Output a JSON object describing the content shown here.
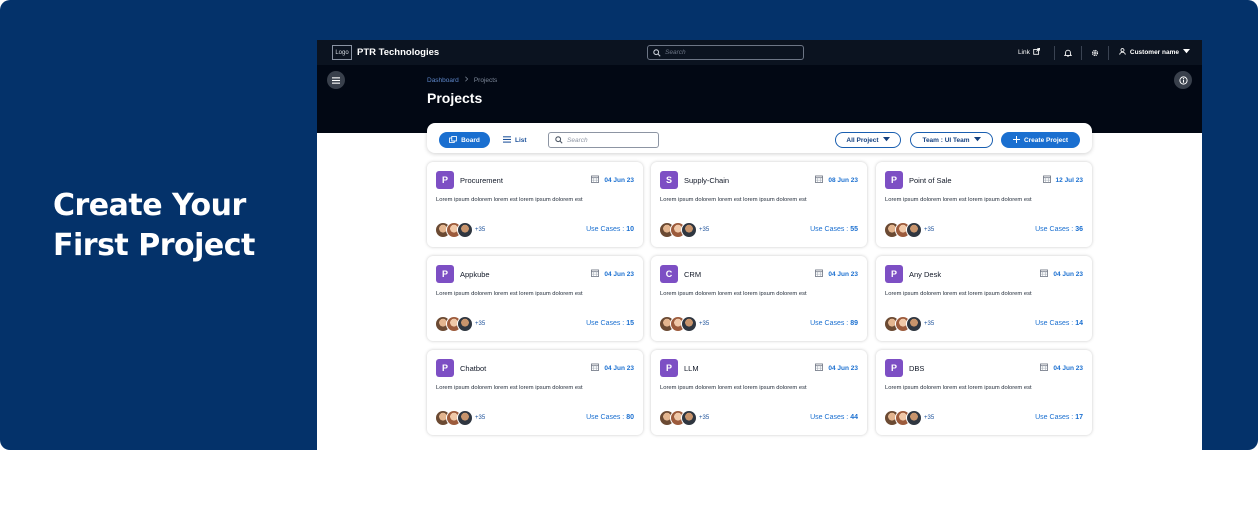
{
  "banner": {
    "headline": "Create Your First Project"
  },
  "topbar": {
    "logo": "Logo",
    "brand": "PTR Technologies",
    "search_placeholder": "Search",
    "link_label": "Link",
    "customer_name": "Customer name"
  },
  "hero": {
    "breadcrumb": [
      "Dashboard",
      "Projects"
    ],
    "title": "Projects"
  },
  "toolbar": {
    "board_label": "Board",
    "list_label": "List",
    "search_placeholder": "Search",
    "project_filter": "All Project",
    "team_filter": "Team : UI Team",
    "create_label": "Create Project"
  },
  "colors": {
    "banner": "#04326a",
    "accent": "#1a6fd0",
    "avatar": "#7d4fc4",
    "topbar": "#0b1320"
  },
  "cards": [
    {
      "initial": "P",
      "title": "Procurement",
      "date": "04 Jun 23",
      "desc": "Lorem ipsum dolorem lorem est lorem ipsum dolorem est",
      "more": "+35",
      "use_cases_label": "Use Cases :",
      "use_cases": "10"
    },
    {
      "initial": "S",
      "title": "Supply-Chain",
      "date": "08 Jun 23",
      "desc": "Lorem ipsum dolorem lorem est lorem ipsum dolorem est",
      "more": "+35",
      "use_cases_label": "Use Cases :",
      "use_cases": "55"
    },
    {
      "initial": "P",
      "title": "Point of Sale",
      "date": "12 Jul 23",
      "desc": "Lorem ipsum dolorem lorem est lorem ipsum dolorem est",
      "more": "+35",
      "use_cases_label": "Use Cases :",
      "use_cases": "36"
    },
    {
      "initial": "P",
      "title": "Appkube",
      "date": "04 Jun 23",
      "desc": "Lorem ipsum dolorem lorem est lorem ipsum dolorem est",
      "more": "+35",
      "use_cases_label": "Use Cases :",
      "use_cases": "15"
    },
    {
      "initial": "C",
      "title": "CRM",
      "date": "04 Jun 23",
      "desc": "Lorem ipsum dolorem lorem est lorem ipsum dolorem est",
      "more": "+35",
      "use_cases_label": "Use Cases :",
      "use_cases": "89"
    },
    {
      "initial": "P",
      "title": "Any Desk",
      "date": "04 Jun 23",
      "desc": "Lorem ipsum dolorem lorem est lorem ipsum dolorem est",
      "more": "+35",
      "use_cases_label": "Use Cases :",
      "use_cases": "14"
    },
    {
      "initial": "P",
      "title": "Chatbot",
      "date": "04 Jun 23",
      "desc": "Lorem ipsum dolorem lorem est lorem ipsum dolorem est",
      "more": "+35",
      "use_cases_label": "Use Cases :",
      "use_cases": "80"
    },
    {
      "initial": "P",
      "title": "LLM",
      "date": "04 Jun 23",
      "desc": "Lorem ipsum dolorem lorem est lorem ipsum dolorem est",
      "more": "+35",
      "use_cases_label": "Use Cases :",
      "use_cases": "44"
    },
    {
      "initial": "P",
      "title": "DBS",
      "date": "04 Jun 23",
      "desc": "Lorem ipsum dolorem lorem est lorem ipsum dolorem est",
      "more": "+35",
      "use_cases_label": "Use Cases :",
      "use_cases": "17"
    }
  ]
}
